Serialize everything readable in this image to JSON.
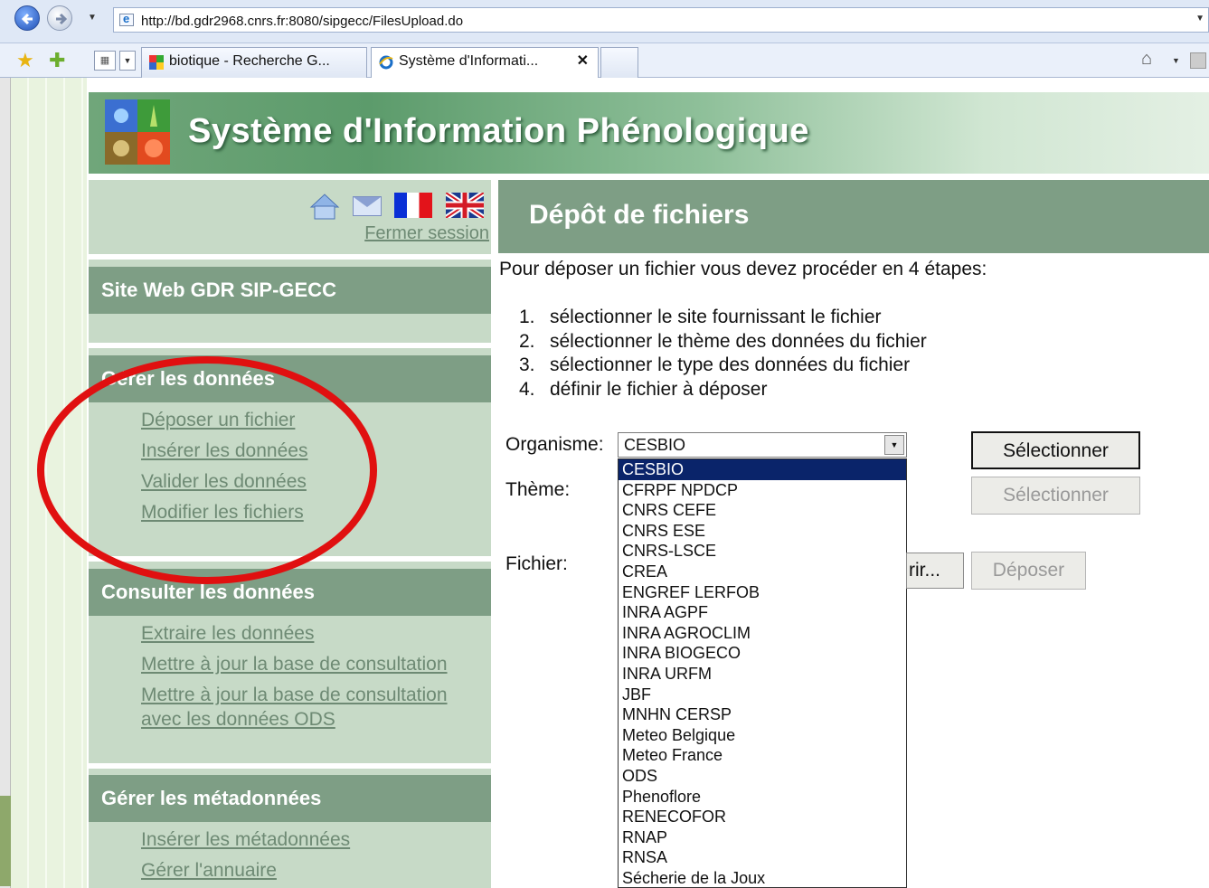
{
  "browser": {
    "url": "http://bd.gdr2968.cnrs.fr:8080/sipgecc/FilesUpload.do",
    "tabs": [
      {
        "label": "biotique - Recherche G..."
      },
      {
        "label": "Système d'Informati..."
      },
      {
        "label": ""
      }
    ]
  },
  "banner": {
    "title": "Système d'Information Phénologique"
  },
  "sidebar": {
    "logout": "Fermer session",
    "sections": [
      {
        "title": "Site Web GDR SIP-GECC",
        "links": []
      },
      {
        "title": "Gérer les données",
        "links": [
          "Déposer un fichier",
          "Insérer les données",
          "Valider les données",
          "Modifier les fichiers"
        ]
      },
      {
        "title": "Consulter les données",
        "links": [
          "Extraire les données",
          "Mettre à jour la base de consultation",
          "Mettre à jour la base de consultation",
          "avec les données ODS"
        ]
      },
      {
        "title": "Gérer les métadonnées",
        "links": [
          "Insérer les métadonnées",
          "Gérer l'annuaire"
        ]
      }
    ]
  },
  "content": {
    "title": "Dépôt de fichiers",
    "intro": "Pour déposer un fichier vous devez procéder en 4 étapes:",
    "steps": [
      {
        "num": "1.",
        "text": "sélectionner le site fournissant le fichier"
      },
      {
        "num": "2.",
        "text": "sélectionner le thème des données du fichier"
      },
      {
        "num": "3.",
        "text": "sélectionner le type des données du fichier"
      },
      {
        "num": "4.",
        "text": "définir le fichier à déposer"
      }
    ]
  },
  "form": {
    "organisme_label": "Organisme:",
    "theme_label": "Thème:",
    "fichier_label": "Fichier:",
    "organisme_value": "CESBIO",
    "select_button": "Sélectionner",
    "select_theme_button": "Sélectionner",
    "browse_button": "rir...",
    "deposit_button": "Déposer",
    "options": [
      "CESBIO",
      "CFRPF NPDCP",
      "CNRS CEFE",
      "CNRS ESE",
      "CNRS-LSCE",
      "CREA",
      "ENGREF LERFOB",
      "INRA AGPF",
      "INRA AGROCLIM",
      "INRA BIOGECO",
      "INRA URFM",
      "JBF",
      "MNHN CERSP",
      "Meteo Belgique",
      "Meteo France",
      "ODS",
      "Phenoflore",
      "RENECOFOR",
      "RNAP",
      "RNSA",
      "Sécherie de la Joux"
    ]
  },
  "colors": {
    "accent_green": "#7e9e85",
    "sidebar_bg": "#c7dac7",
    "link": "#6e8a74",
    "annotation_red": "#e01010",
    "selection": "#0a246a"
  }
}
